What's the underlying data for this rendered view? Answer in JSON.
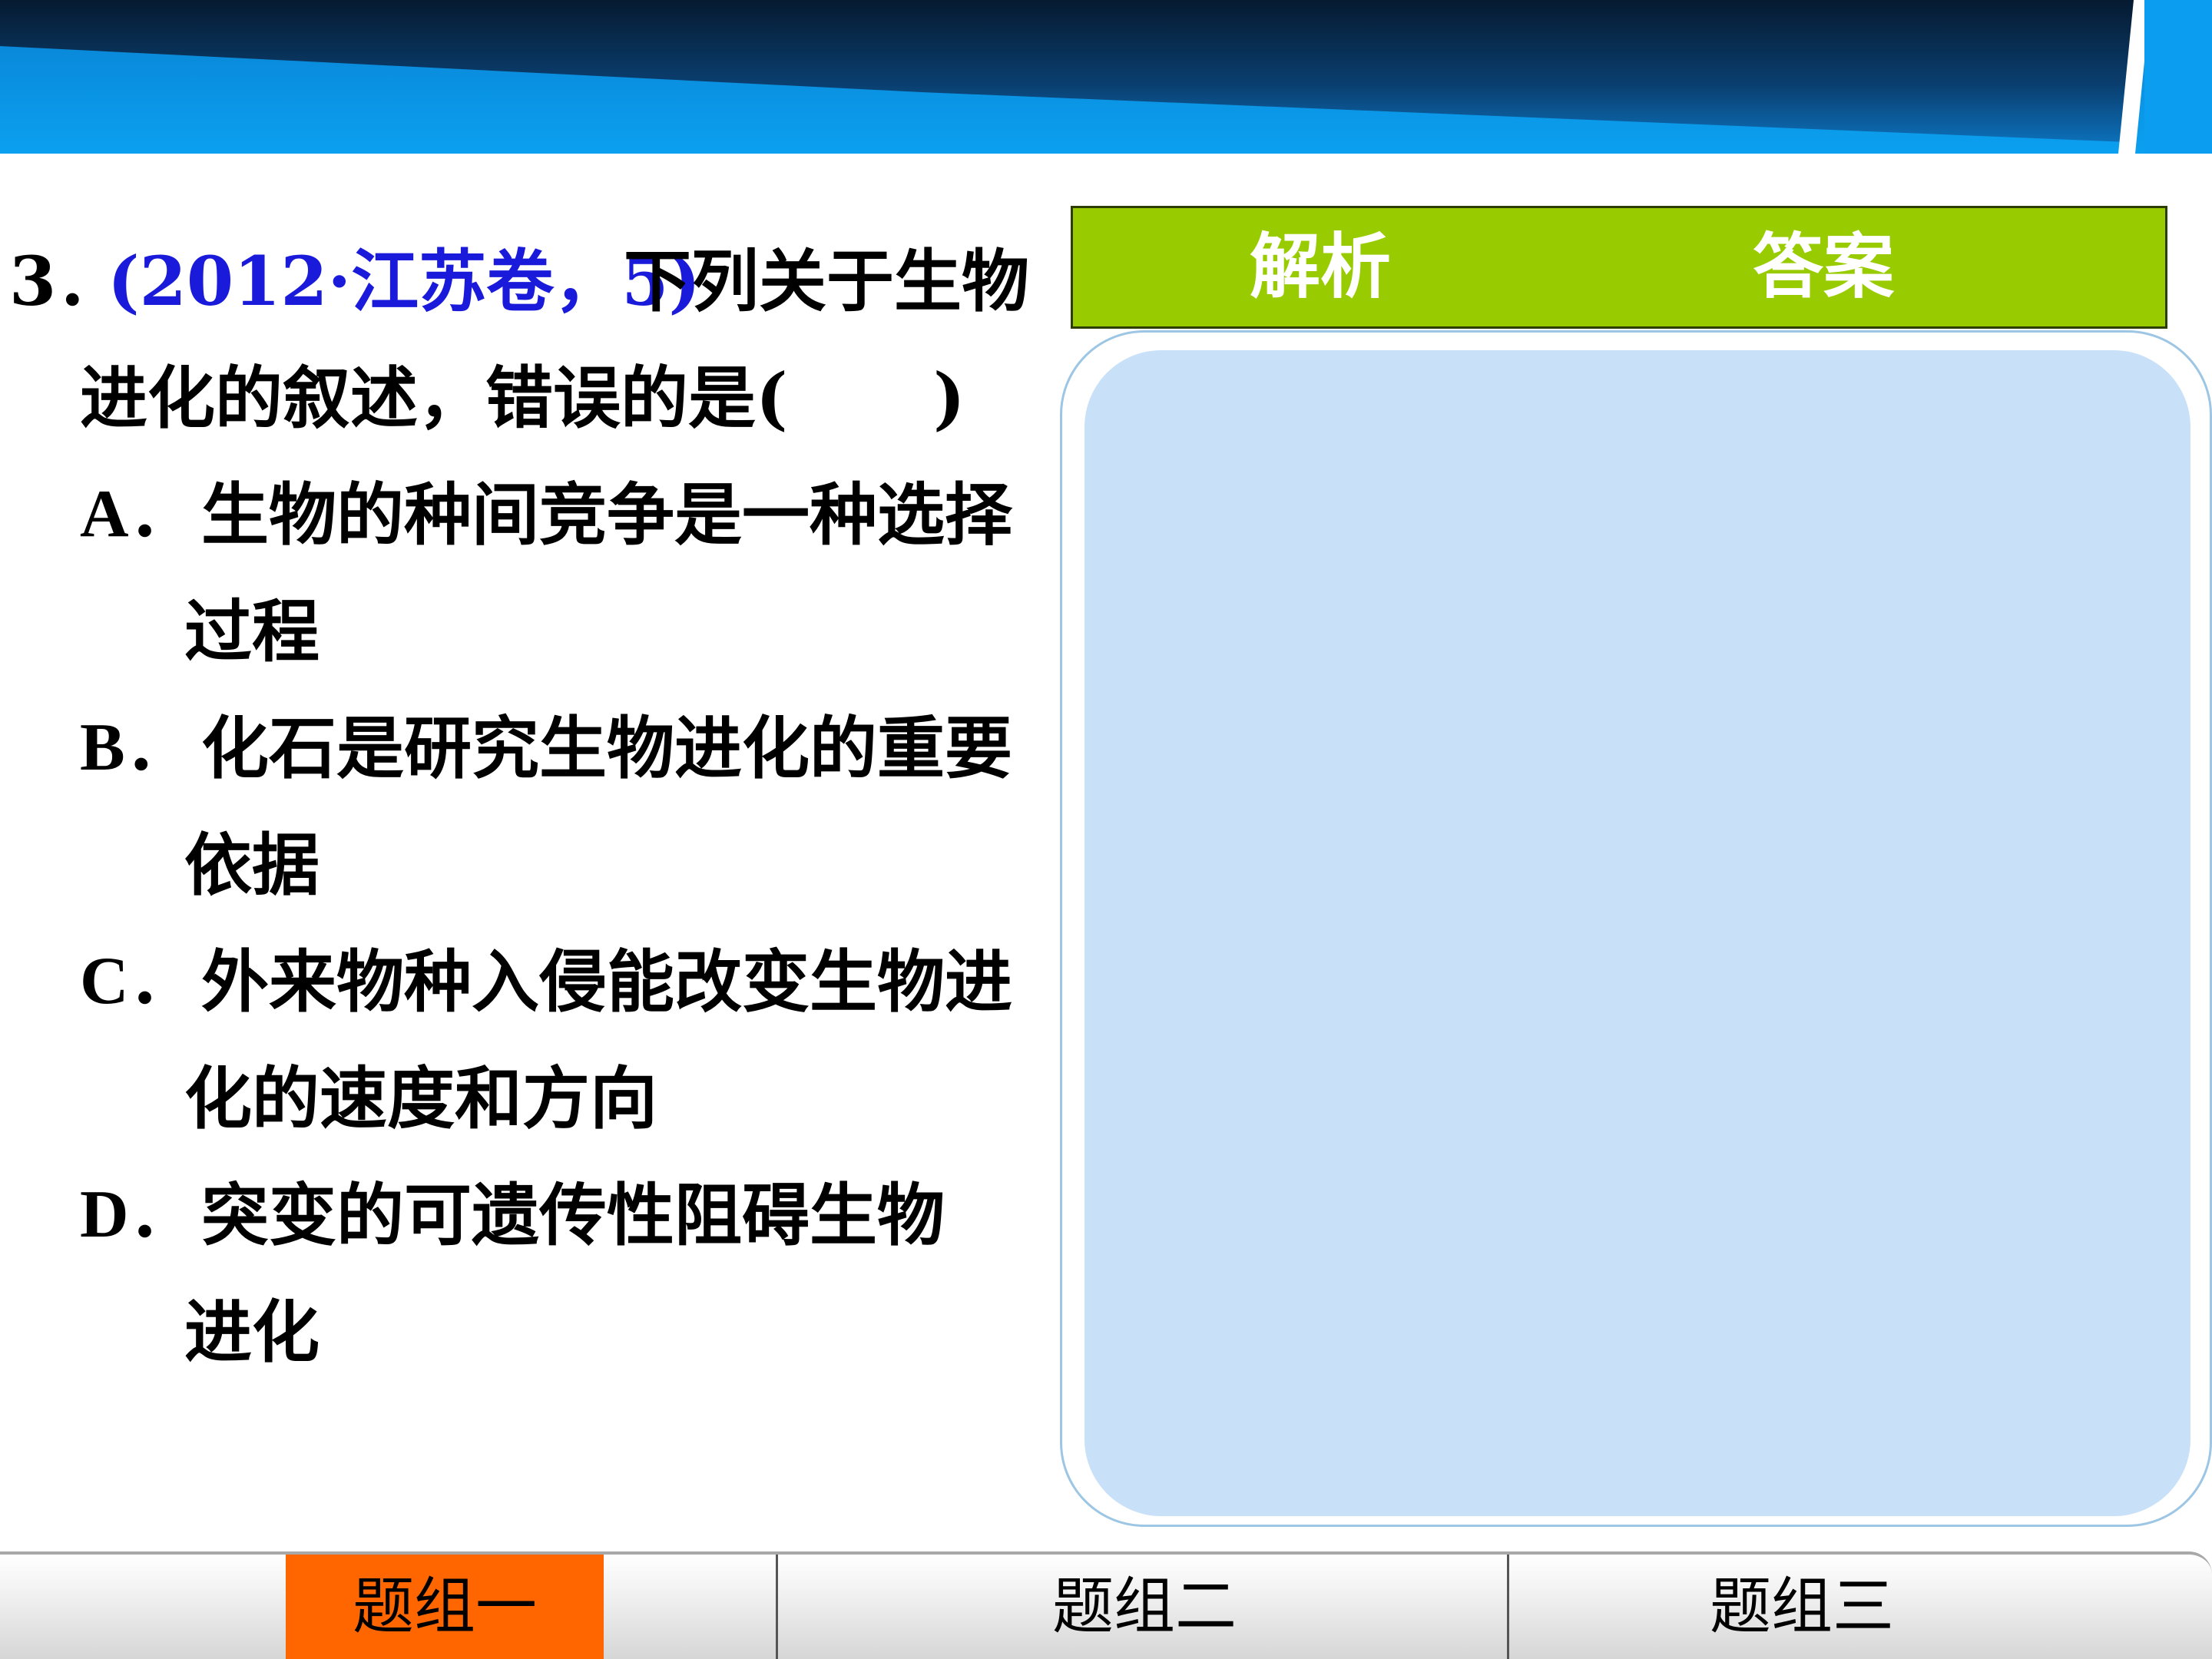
{
  "question": {
    "number": "3．",
    "source": "(2012·江苏卷，5)",
    "stem_line1": "下列关于生物",
    "stem_line2": "进化的叙述，错误的是(",
    "stem_blank_close": ")",
    "options": [
      {
        "letter": "A．",
        "line1": "生物的种间竞争是一种选择",
        "line2": "过程"
      },
      {
        "letter": "B．",
        "line1": "化石是研究生物进化的重要",
        "line2": "依据"
      },
      {
        "letter": "C．",
        "line1": "外来物种入侵能改变生物进",
        "line2": "化的速度和方向"
      },
      {
        "letter": "D．",
        "line1": "突变的可遗传性阻碍生物",
        "line2": "进化"
      }
    ]
  },
  "header": {
    "analysis_label": "解析",
    "answer_label": "答案"
  },
  "nav": {
    "tabs": [
      {
        "label": "题组一",
        "active": true
      },
      {
        "label": "题组二",
        "active": false
      },
      {
        "label": "题组三",
        "active": false
      }
    ]
  },
  "colors": {
    "banner_blue": "#0a96e6",
    "banner_dark": "#041e3a",
    "source_blue": "#1a1adb",
    "header_green": "#99cc00",
    "panel_blue": "#c8e1f8",
    "active_tab": "#ff6600"
  }
}
